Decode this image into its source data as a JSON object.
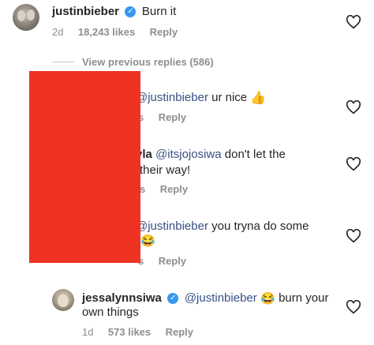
{
  "top_comment": {
    "username": "justinbieber",
    "text": "Burn it",
    "age": "2d",
    "likes": "18,243 likes",
    "reply_label": "Reply"
  },
  "view_replies": {
    "label": "View previous replies (586)"
  },
  "replies": [
    {
      "username": "",
      "mention": "@justinbieber",
      "text_line1": " ur nice ",
      "emoji": "thumbs-up",
      "meta_fragment": "s",
      "reply_label": "Reply"
    },
    {
      "username_fragment": "yla",
      "mention": "@itsjojosiwa",
      "text_line1": " don't let the",
      "text_line2": "their way!",
      "meta_fragment": "s",
      "reply_label": "Reply"
    },
    {
      "mention": "@justinbieber",
      "text_line1": " you tryna do some",
      "text_line2_fragment": ")",
      "emoji": "laughing-tears",
      "meta_fragment": "s",
      "reply_label": "Reply"
    },
    {
      "username": "jessalynnsiwa",
      "mention": "@justinbieber",
      "emoji": "laughing-tears",
      "text_line1": " burn your",
      "text_line2": "own things",
      "age": "1d",
      "likes": "573 likes",
      "reply_label": "Reply"
    }
  ],
  "colors": {
    "redaction": "#ee3322",
    "mention": "#385185",
    "verified": "#3897f0",
    "meta": "#8e8e8e"
  }
}
